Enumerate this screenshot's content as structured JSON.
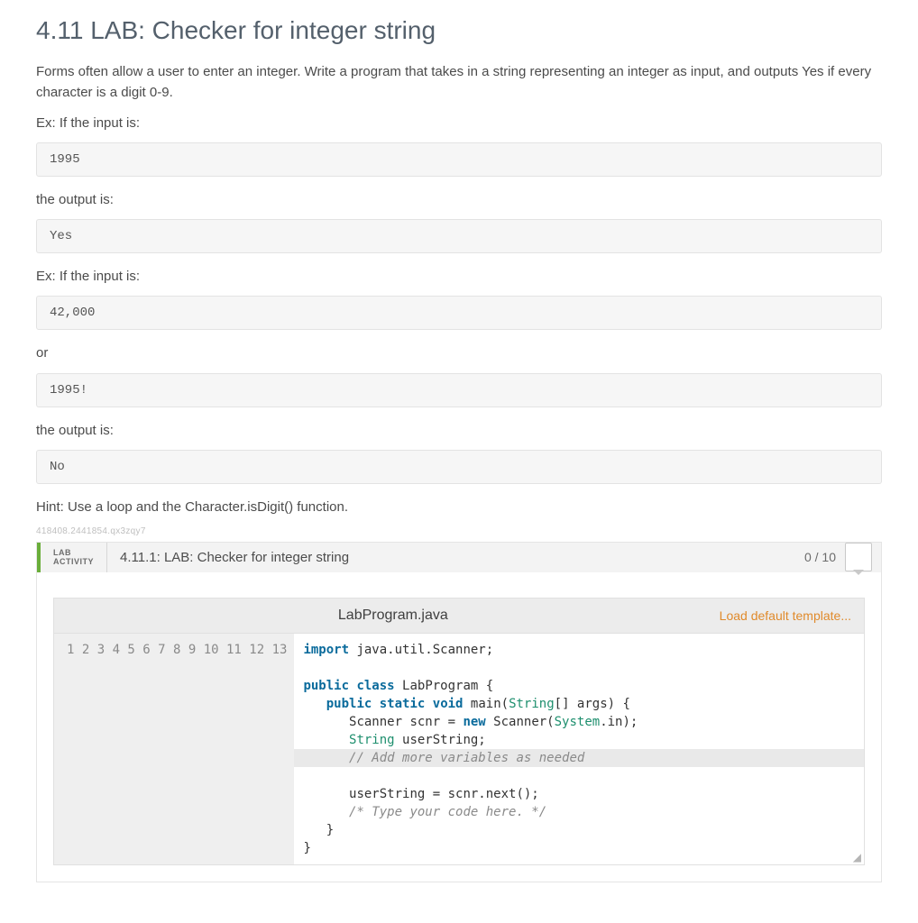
{
  "title": "4.11 LAB: Checker for integer string",
  "intro": "Forms often allow a user to enter an integer. Write a program that takes in a string representing an integer as input, and outputs Yes if every character is a digit 0-9.",
  "ex1_label": "Ex: If the input is:",
  "ex1_in": "1995",
  "out_label": "the output is:",
  "ex1_out": "Yes",
  "ex2_label": "Ex: If the input is:",
  "ex2_in": "42,000",
  "or_label": "or",
  "ex2_in_b": "1995!",
  "ex2_out": "No",
  "hint": "Hint: Use a loop and the Character.isDigit() function.",
  "res_id": "418408.2441854.qx3zqy7",
  "lab_tag_l1": "LAB",
  "lab_tag_l2": "ACTIVITY",
  "lab_title": "4.11.1: LAB: Checker for integer string",
  "lab_score": "0 / 10",
  "filename": "LabProgram.java",
  "template_link": "Load default template...",
  "gutter": "1\n2\n3\n4\n5\n6\n7\n8\n9\n10\n11\n12\n13",
  "code": {
    "l1a": "import",
    "l1b": " java.util.Scanner;",
    "l3a": "public",
    "l3b": "class",
    "l3c": " LabProgram {",
    "l4a": "public",
    "l4b": "static",
    "l4c": "void",
    "l4d": " main(",
    "l4e": "String",
    "l4f": "[] args) {",
    "l5a": "      Scanner scnr = ",
    "l5b": "new",
    "l5c": " Scanner(",
    "l5d": "System",
    "l5e": ".in);",
    "l6a": "String",
    "l6b": " userString;",
    "l7": "      // Add more variables as needed",
    "l9": "      userString = scnr.next();",
    "l10": "      /* Type your code here. */",
    "l11": "   }",
    "l12": "}"
  }
}
